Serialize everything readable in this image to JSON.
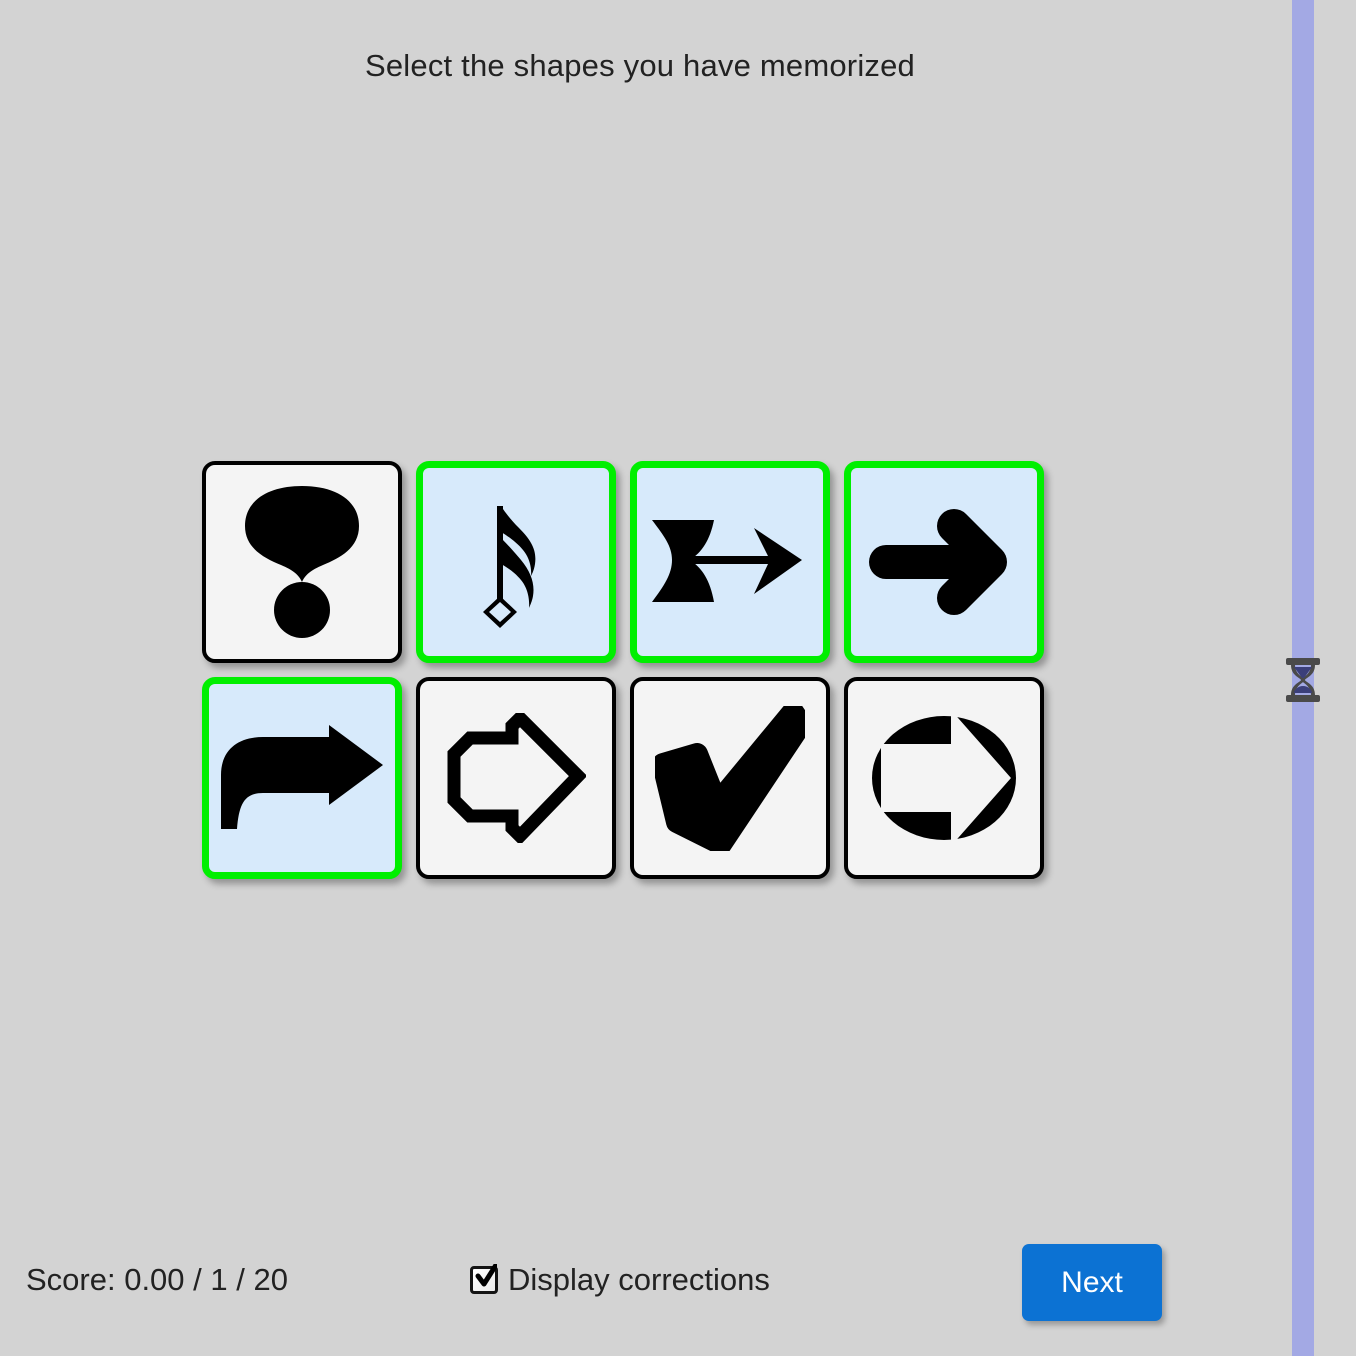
{
  "screen": {
    "background_color": "#d3d3d3",
    "title": "Select the shapes you have memorized"
  },
  "grid": {
    "rows": 2,
    "columns": 4,
    "tiles": [
      {
        "id": "tile-1",
        "icon": "exclamation-mark-icon",
        "label": "heavy exclamation mark",
        "selected": false,
        "row": 1,
        "column": 1
      },
      {
        "id": "tile-2",
        "icon": "music-note-icon",
        "label": "sixteenth note with diamond head",
        "selected": true,
        "row": 1,
        "column": 2
      },
      {
        "id": "tile-3",
        "icon": "double-arrow-right-icon",
        "label": "feathered double arrow right",
        "selected": true,
        "row": 1,
        "column": 3
      },
      {
        "id": "tile-4",
        "icon": "arrow-right-icon",
        "label": "rounded arrow right",
        "selected": true,
        "row": 1,
        "column": 4
      },
      {
        "id": "tile-5",
        "icon": "curved-arrow-right-icon",
        "label": "curved arrow right",
        "selected": true,
        "row": 2,
        "column": 1
      },
      {
        "id": "tile-6",
        "icon": "outline-arrow-right-icon",
        "label": "outlined arrow right",
        "selected": false,
        "row": 2,
        "column": 2
      },
      {
        "id": "tile-7",
        "icon": "check-mark-icon",
        "label": "heavy check mark",
        "selected": false,
        "row": 2,
        "column": 3
      },
      {
        "id": "tile-8",
        "icon": "circled-arrow-right-icon",
        "label": "arrow right in circle",
        "selected": false,
        "row": 2,
        "column": 4
      }
    ],
    "colors": {
      "tile_background": "#f4f4f4",
      "tile_border": "#000000",
      "selected_background": "#d7eafb",
      "selected_border": "#00ef00"
    }
  },
  "footer": {
    "score_text": "Score: 0.00 / 1 / 20",
    "score_value": "0.00",
    "trial_number": "1",
    "trial_total": "20",
    "corrections_label": "Display corrections",
    "corrections_checked": true,
    "next_label": "Next"
  },
  "timer": {
    "icon": "hourglass-icon",
    "bar_color": "#a3a9e4",
    "progress_percent": 100
  }
}
